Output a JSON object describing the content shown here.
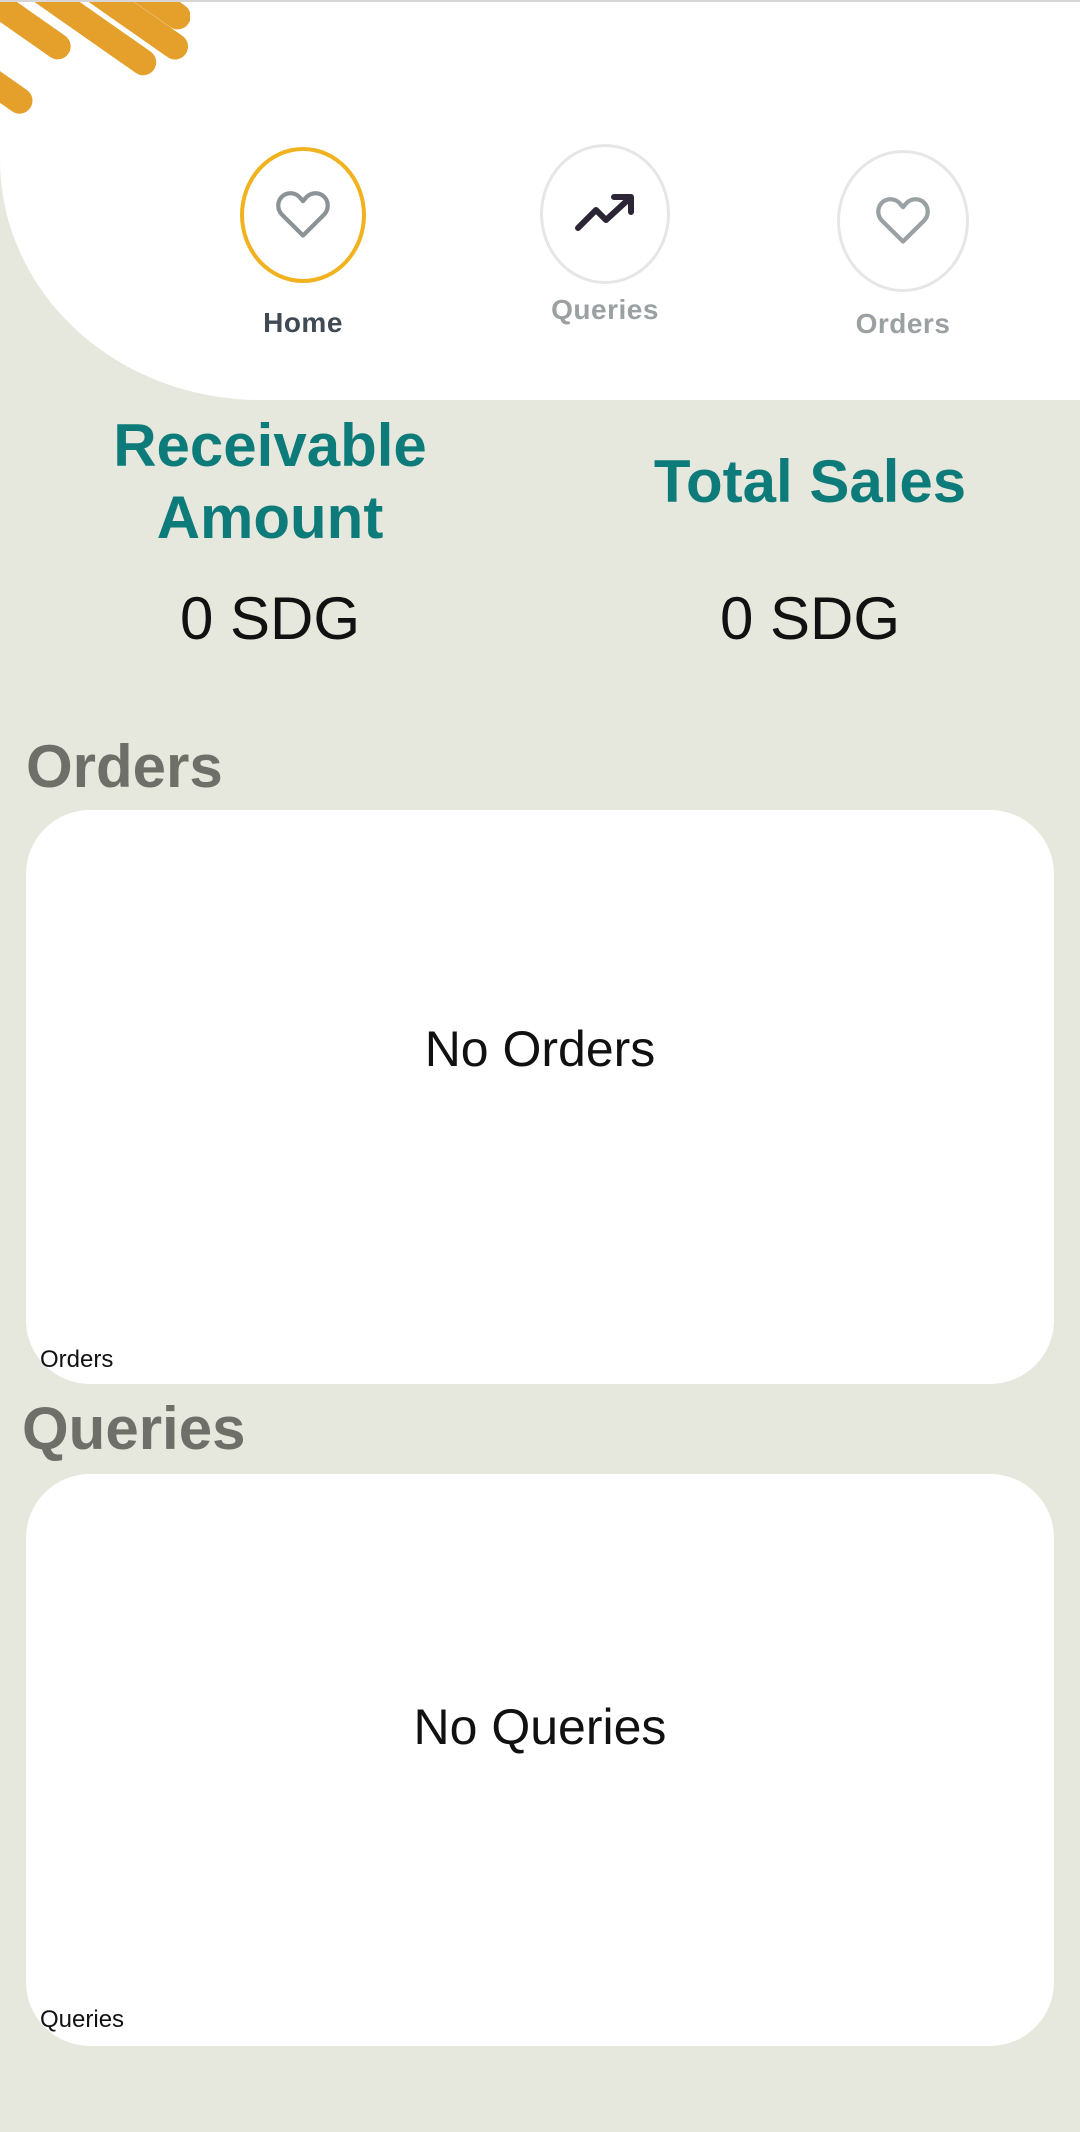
{
  "nav": {
    "items": [
      {
        "label": "Home",
        "icon": "heart-icon",
        "active": true
      },
      {
        "label": "Queries",
        "icon": "trending-up-icon",
        "active": false
      },
      {
        "label": "Orders",
        "icon": "heart-icon",
        "active": false
      }
    ]
  },
  "stats": {
    "receivable": {
      "title_line1": "Receivable",
      "title_line2": "Amount",
      "value": "0 SDG"
    },
    "total_sales": {
      "title": "Total Sales",
      "value": "0 SDG"
    }
  },
  "orders": {
    "title": "Orders",
    "empty_text": "No Orders",
    "caption": "Orders"
  },
  "queries": {
    "title": "Queries",
    "empty_text": "No Queries",
    "caption": "Queries"
  },
  "colors": {
    "accent": "#f1b21f",
    "decor": "#e4a02a",
    "teal": "#0e7b7b",
    "background": "#e7e8dd",
    "section_title": "#6e6f68"
  }
}
